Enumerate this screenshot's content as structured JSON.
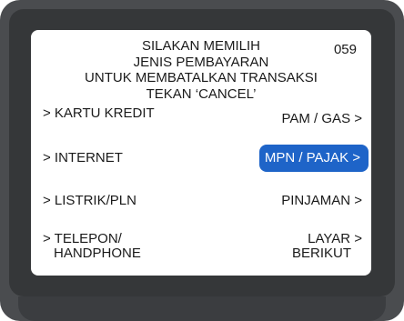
{
  "screen": {
    "header_lines": [
      "SILAKAN MEMILIH",
      "JENIS PEMBAYARAN",
      "UNTUK MEMBATALKAN TRANSAKSI",
      "TEKAN ‘CANCEL’"
    ],
    "code": "059"
  },
  "options": {
    "left": [
      {
        "label": "> KARTU KREDIT"
      },
      {
        "label": "> INTERNET"
      },
      {
        "label": "> LISTRIK/PLN"
      },
      {
        "label_lines": [
          "> TELEPON/",
          "HANDPHONE"
        ]
      }
    ],
    "right": [
      {
        "label": "PAM / GAS >"
      },
      {
        "label": "MPN / PAJAK >",
        "selected": true
      },
      {
        "label": "PINJAMAN >"
      },
      {
        "label_lines": [
          "LAYAR >",
          "BERIKUT"
        ]
      }
    ]
  },
  "colors": {
    "bezel": "#4a4c4f",
    "bezel_inner": "#353739",
    "screen": "#ffffff",
    "text": "#1a1a1a",
    "highlight": "#1e64c8",
    "highlight_text": "#ffffff"
  }
}
